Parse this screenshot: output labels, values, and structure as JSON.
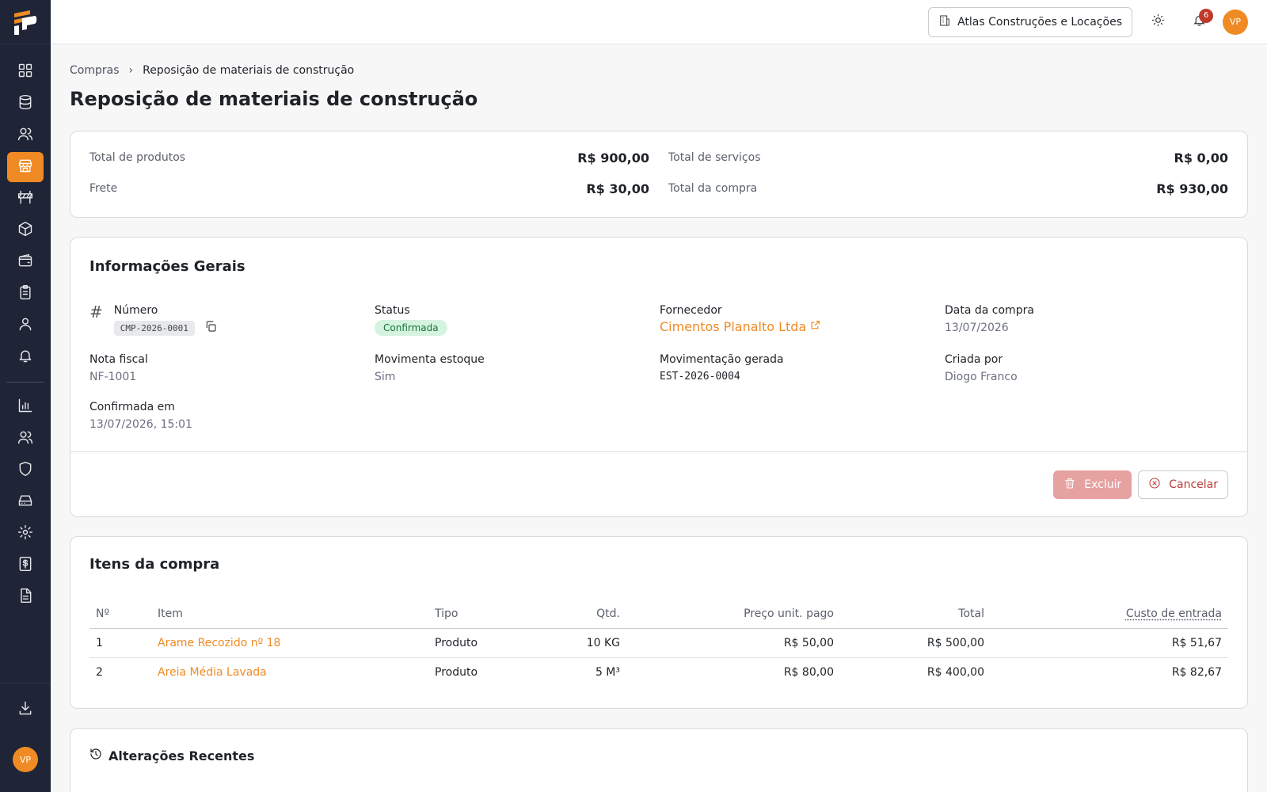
{
  "brand": {
    "logo": "logo-icon",
    "accent": "#f08a24",
    "sidebar_bg": "#1f2536"
  },
  "sidebar": {
    "top_items": [
      {
        "icon": "dashboard-icon"
      },
      {
        "icon": "database-icon"
      },
      {
        "icon": "users-icon"
      },
      {
        "icon": "store-icon",
        "active": true
      },
      {
        "icon": "barrier-icon"
      },
      {
        "icon": "box-icon"
      },
      {
        "icon": "wallet-icon"
      },
      {
        "icon": "clipboard-icon"
      },
      {
        "icon": "user-icon"
      },
      {
        "icon": "bell-icon"
      }
    ],
    "bottom_items": [
      {
        "icon": "bar-chart-icon"
      },
      {
        "icon": "team-icon"
      },
      {
        "icon": "shield-icon"
      },
      {
        "icon": "drive-icon"
      },
      {
        "icon": "settings-icon"
      },
      {
        "icon": "invoice-icon"
      },
      {
        "icon": "document-icon"
      }
    ],
    "download_icon": "download-icon",
    "avatar_initials": "VP"
  },
  "topbar": {
    "company": "Atlas Construções e Locações",
    "notifications_count": "6",
    "avatar_initials": "VP"
  },
  "breadcrumb": {
    "parent": "Compras",
    "current": "Reposição de materiais de construção"
  },
  "page_title": "Reposição de materiais de construção",
  "totals": {
    "products_label": "Total de produtos",
    "products_value": "R$ 900,00",
    "services_label": "Total de serviços",
    "services_value": "R$ 0,00",
    "freight_label": "Frete",
    "freight_value": "R$ 30,00",
    "purchase_label": "Total da compra",
    "purchase_value": "R$ 930,00"
  },
  "info": {
    "title": "Informações Gerais",
    "numero_label": "Número",
    "numero_value": "CMP-2026-0001",
    "status_label": "Status",
    "status_value": "Confirmada",
    "fornecedor_label": "Fornecedor",
    "fornecedor_value": "Cimentos Planalto Ltda",
    "data_label": "Data da compra",
    "data_value": "13/07/2026",
    "nota_label": "Nota fiscal",
    "nota_value": "NF-1001",
    "movimenta_label": "Movimenta estoque",
    "movimenta_value": "Sim",
    "movgerada_label": "Movimentação gerada",
    "movgerada_value": "EST-2026-0004",
    "criada_label": "Criada por",
    "criada_value": "Diogo Franco",
    "confirmada_label": "Confirmada em",
    "confirmada_value": "13/07/2026, 15:01",
    "excluir_label": "Excluir",
    "cancelar_label": "Cancelar"
  },
  "items": {
    "title": "Itens da compra",
    "headers": {
      "n": "Nº",
      "item": "Item",
      "tipo": "Tipo",
      "qtd": "Qtd.",
      "preco": "Preço unit. pago",
      "total": "Total",
      "custo": "Custo de entrada"
    },
    "rows": [
      {
        "n": "1",
        "item": "Arame Recozido nº 18",
        "tipo": "Produto",
        "qtd": "10 KG",
        "preco": "R$ 50,00",
        "total": "R$ 500,00",
        "custo": "R$ 51,67"
      },
      {
        "n": "2",
        "item": "Areia Média Lavada",
        "tipo": "Produto",
        "qtd": "5 M³",
        "preco": "R$ 80,00",
        "total": "R$ 400,00",
        "custo": "R$ 82,67"
      }
    ]
  },
  "recent": {
    "title": "Alterações Recentes"
  }
}
